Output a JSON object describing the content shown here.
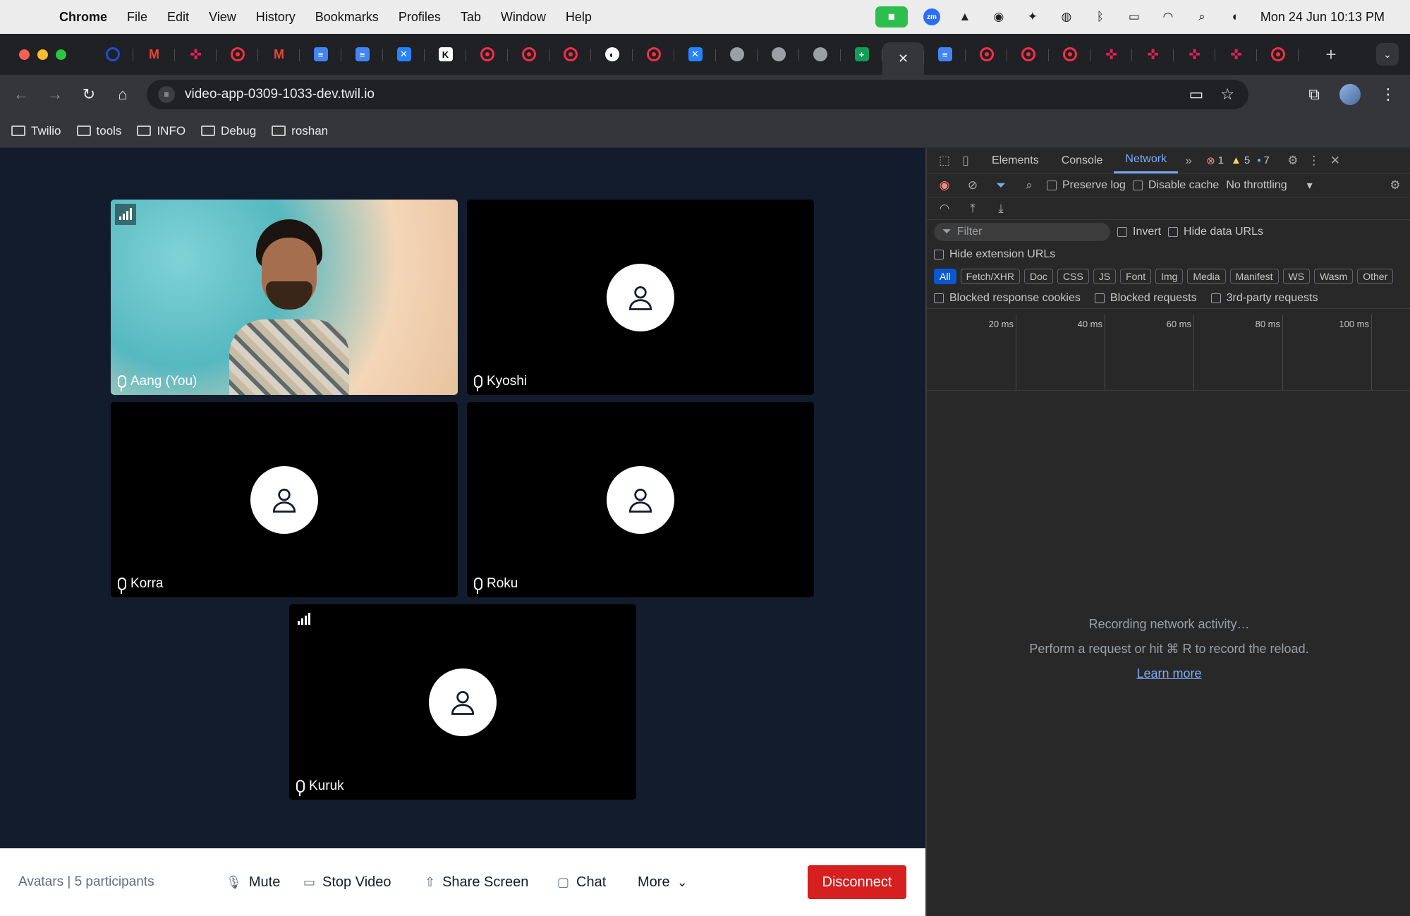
{
  "menubar": {
    "app": "Chrome",
    "items": [
      "File",
      "Edit",
      "View",
      "History",
      "Bookmarks",
      "Profiles",
      "Tab",
      "Window",
      "Help"
    ],
    "clock": "Mon 24 Jun  10:13 PM"
  },
  "browser": {
    "url": "video-app-0309-1033-dev.twil.io",
    "tabs": [
      "ocircle",
      "gmail",
      "slack",
      "twilio",
      "gmail",
      "docs",
      "docs",
      "blue",
      "k",
      "twilio",
      "twilio",
      "twilio",
      "gh",
      "twilio",
      "blue",
      "globe",
      "globe",
      "globe",
      "sheet",
      "active",
      "docs",
      "twilio",
      "twilio",
      "twilio",
      "slack",
      "slack",
      "slack",
      "slack",
      "twilio"
    ],
    "bookmarks": [
      "Twilio",
      "tools",
      "INFO",
      "Debug",
      "roshan"
    ]
  },
  "video": {
    "participants": [
      {
        "name": "Aang (You)",
        "has_video": true
      },
      {
        "name": "Kyoshi",
        "has_video": false
      },
      {
        "name": "Korra",
        "has_video": false
      },
      {
        "name": "Roku",
        "has_video": false
      },
      {
        "name": "Kuruk",
        "has_video": false
      }
    ],
    "room_label": "Avatars | 5 participants",
    "controls": {
      "mute": "Mute",
      "stop_video": "Stop Video",
      "share_screen": "Share Screen",
      "chat": "Chat",
      "more": "More",
      "disconnect": "Disconnect"
    },
    "accent_color": "#d61f1f"
  },
  "devtools": {
    "tabs": [
      "Elements",
      "Console",
      "Network"
    ],
    "selected_tab": "Network",
    "errors": "1",
    "warnings": "5",
    "messages": "7",
    "preserve_log": "Preserve log",
    "disable_cache": "Disable cache",
    "throttling": "No throttling",
    "filter_placeholder": "Filter",
    "invert": "Invert",
    "hide_data_urls": "Hide data URLs",
    "hide_extension_urls": "Hide extension URLs",
    "type_filters": [
      "All",
      "Fetch/XHR",
      "Doc",
      "CSS",
      "JS",
      "Font",
      "Img",
      "Media",
      "Manifest",
      "WS",
      "Wasm",
      "Other"
    ],
    "blocked_response_cookies": "Blocked response cookies",
    "blocked_requests": "Blocked requests",
    "third_party": "3rd-party requests",
    "timeline_ticks": [
      "20 ms",
      "40 ms",
      "60 ms",
      "80 ms",
      "100 ms"
    ],
    "recording": "Recording network activity…",
    "hint": "Perform a request or hit ⌘ R to record the reload.",
    "learn_more": "Learn more"
  }
}
